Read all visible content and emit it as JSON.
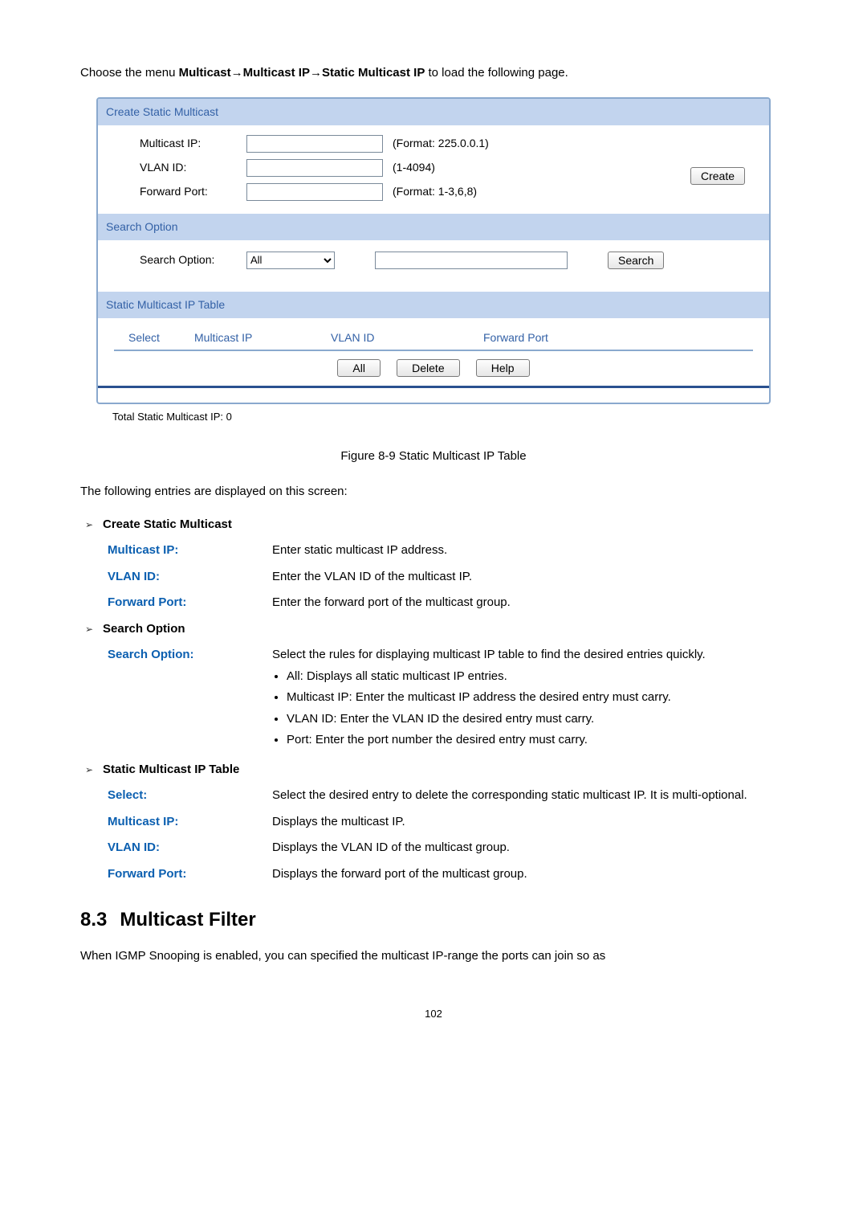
{
  "intro": {
    "prefix": "Choose the menu ",
    "path1": "Multicast",
    "sep": "→",
    "path2": "Multicast IP",
    "path3": "Static Multicast IP",
    "suffix": " to load the following page."
  },
  "panel": {
    "createHeader": "Create Static Multicast",
    "multicastLabel": "Multicast IP:",
    "multicastHint": "(Format: 225.0.0.1)",
    "vlanLabel": "VLAN ID:",
    "vlanHint": "(1-4094)",
    "portLabel": "Forward Port:",
    "portHint": "(Format: 1-3,6,8)",
    "createBtn": "Create",
    "searchHeader": "Search Option",
    "searchLabel": "Search Option:",
    "searchSelect": "All",
    "searchBtn": "Search",
    "tableHeader": "Static Multicast IP Table",
    "thSelect": "Select",
    "thMip": "Multicast IP",
    "thVlan": "VLAN ID",
    "thPort": "Forward Port",
    "btnAll": "All",
    "btnDelete": "Delete",
    "btnHelp": "Help",
    "total": "Total Static Multicast IP: 0"
  },
  "figCaption": "Figure 8-9 Static Multicast IP Table",
  "entriesIntro": "The following entries are displayed on this screen:",
  "groups": {
    "createTitle": "Create Static Multicast",
    "create": {
      "multicastTerm": "Multicast IP:",
      "multicastDesc": "Enter static multicast IP address.",
      "vlanTerm": "VLAN ID:",
      "vlanDesc": "Enter the VLAN ID of the multicast IP.",
      "portTerm": "Forward Port:",
      "portDesc": "Enter the forward port of the multicast group."
    },
    "searchTitle": "Search Option",
    "search": {
      "term": "Search Option:",
      "descIntro": "Select the rules for displaying multicast IP table to find the desired entries quickly.",
      "b1": "All: Displays all static multicast IP entries.",
      "b2": "Multicast IP: Enter the multicast IP address the desired entry must carry.",
      "b3": "VLAN ID: Enter the VLAN ID the desired entry must carry.",
      "b4": "Port: Enter the port number the desired entry must carry."
    },
    "tableTitle": "Static Multicast IP Table",
    "table": {
      "selectTerm": "Select:",
      "selectDesc": "Select the desired entry to delete the corresponding static multicast IP. It is multi-optional.",
      "mipTerm": "Multicast IP:",
      "mipDesc": "Displays the multicast IP.",
      "vlanTerm": "VLAN ID:",
      "vlanDesc": "Displays the VLAN ID of the multicast group.",
      "portTerm": "Forward Port:",
      "portDesc": "Displays the forward port of the multicast group."
    }
  },
  "sectionNumber": "8.3",
  "sectionTitle": "Multicast Filter",
  "bodyP": "When IGMP Snooping is enabled, you can specified the multicast IP-range the ports can join so as",
  "pageNumber": "102"
}
